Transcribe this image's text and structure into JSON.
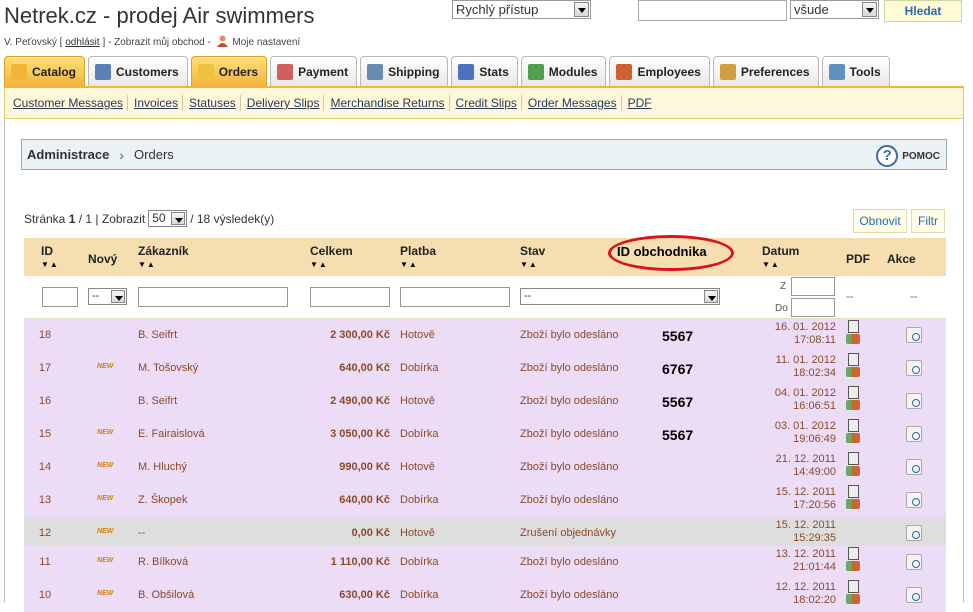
{
  "site_title": "Netrek.cz - prodej Air swimmers",
  "quick_access": "Rychlý přístup",
  "search": {
    "scope": "všude",
    "button": "Hledat"
  },
  "user_line": {
    "name": "V. Peťovský [",
    "logout": "odhlásit",
    "mid": "] - Zobrazit můj obchod -",
    "settings": "Moje nastavení"
  },
  "tabs": [
    {
      "label": "Catalog",
      "color": "#f2b53a"
    },
    {
      "label": "Customers",
      "color": "#5d7fb8"
    },
    {
      "label": "Orders",
      "color": "#f0c040"
    },
    {
      "label": "Payment",
      "color": "#d06060"
    },
    {
      "label": "Shipping",
      "color": "#6a8ab0"
    },
    {
      "label": "Stats",
      "color": "#5070c0"
    },
    {
      "label": "Modules",
      "color": "#50a050"
    },
    {
      "label": "Employees",
      "color": "#d06030"
    },
    {
      "label": "Preferences",
      "color": "#d0a040"
    },
    {
      "label": "Tools",
      "color": "#6090c0"
    }
  ],
  "subnav": [
    "Customer Messages",
    "Invoices",
    "Statuses",
    "Delivery Slips",
    "Merchandise Returns",
    "Credit Slips",
    "Order Messages",
    "PDF"
  ],
  "breadcrumb": {
    "root": "Administrace",
    "page": "Orders",
    "help": "POMOC"
  },
  "pager": {
    "prefix": "Stránka",
    "page": "1",
    "of": "/ 1 | Zobrazit",
    "per_page": "50",
    "results": "/ 18 výsledek(y)"
  },
  "buttons": {
    "refresh": "Obnovit",
    "filter": "Filtr"
  },
  "columns": {
    "id": "ID",
    "new": "Nový",
    "customer": "Zákazník",
    "total": "Celkem",
    "payment": "Platba",
    "state": "Stav",
    "merchant": "ID obchodnika",
    "date": "Datum",
    "pdf": "PDF",
    "actions": "Akce"
  },
  "filters": {
    "new": "--",
    "state": "--",
    "date_from": "Z",
    "date_to": "Do",
    "pdf": "--",
    "actions": "--"
  },
  "new_badge": "NEW",
  "rows": [
    {
      "id": "18",
      "new": "",
      "customer": "B. Seifrt",
      "total": "2 300,00 Kč",
      "payment": "Hotově",
      "state": "Zboží bylo odesláno",
      "merchant": "5567",
      "date": "16. 01. 2012",
      "time": "17:08:11"
    },
    {
      "id": "17",
      "new": "NEW",
      "customer": "M. Tošovský",
      "total": "640,00 Kč",
      "payment": "Dobírka",
      "state": "Zboží bylo odesláno",
      "merchant": "6767",
      "date": "11. 01. 2012",
      "time": "18:02:34"
    },
    {
      "id": "16",
      "new": "",
      "customer": "B. Seifrt",
      "total": "2 490,00 Kč",
      "payment": "Hotově",
      "state": "Zboží bylo odesláno",
      "merchant": "5567",
      "date": "04. 01. 2012",
      "time": "16:06:51"
    },
    {
      "id": "15",
      "new": "NEW",
      "customer": "E. Fairaislová",
      "total": "3 050,00 Kč",
      "payment": "Dobírka",
      "state": "Zboží bylo odesláno",
      "merchant": "5567",
      "date": "03. 01. 2012",
      "time": "19:06:49"
    },
    {
      "id": "14",
      "new": "NEW",
      "customer": "M. Hluchý",
      "total": "990,00 Kč",
      "payment": "Hotově",
      "state": "Zboží bylo odesláno",
      "merchant": "",
      "date": "21. 12. 2011",
      "time": "14:49:00"
    },
    {
      "id": "13",
      "new": "NEW",
      "customer": "Z. Škopek",
      "total": "640,00 Kč",
      "payment": "Dobírka",
      "state": "Zboží bylo odesláno",
      "merchant": "",
      "date": "15. 12. 2011",
      "time": "17:20:56"
    },
    {
      "id": "12",
      "new": "NEW",
      "customer": "--",
      "total": "0,00 Kč",
      "payment": "Hotově",
      "state": "Zrušení objednávky",
      "merchant": "",
      "date": "15. 12. 2011",
      "time": "15:29:35",
      "cancelled": true
    },
    {
      "id": "11",
      "new": "NEW",
      "customer": "R. Bílková",
      "total": "1 110,00 Kč",
      "payment": "Dobírka",
      "state": "Zboží bylo odesláno",
      "merchant": "",
      "date": "13. 12. 2011",
      "time": "21:01:44"
    },
    {
      "id": "10",
      "new": "NEW",
      "customer": "B. Obšilová",
      "total": "630,00 Kč",
      "payment": "Dobírka",
      "state": "Zboží bylo odesláno",
      "merchant": "",
      "date": "12. 12. 2011",
      "time": "18:02:20"
    }
  ]
}
